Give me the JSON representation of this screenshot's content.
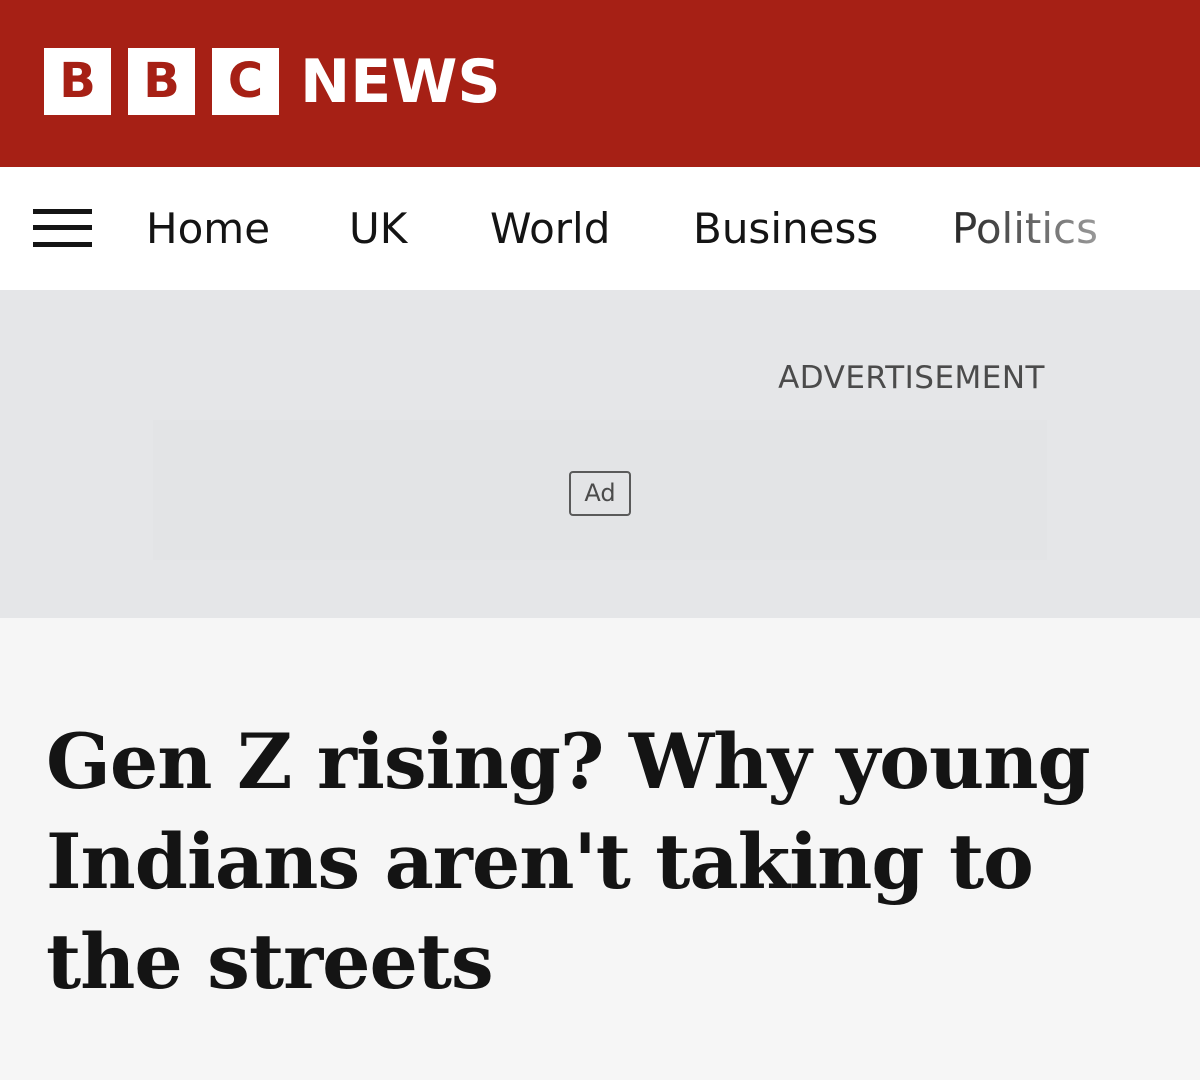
{
  "brand": {
    "letters": [
      "B",
      "B",
      "C"
    ],
    "news_word": "NEWS",
    "color": "#a62015"
  },
  "nav": {
    "menu_icon": "hamburger-menu-icon",
    "items": [
      {
        "label": "Home"
      },
      {
        "label": "UK"
      },
      {
        "label": "World"
      },
      {
        "label": "Business"
      },
      {
        "label": "Politics"
      }
    ]
  },
  "ad": {
    "label": "ADVERTISEMENT",
    "badge": "Ad"
  },
  "article": {
    "headline": "Gen Z rising? Why young Indians aren't taking to the streets"
  }
}
